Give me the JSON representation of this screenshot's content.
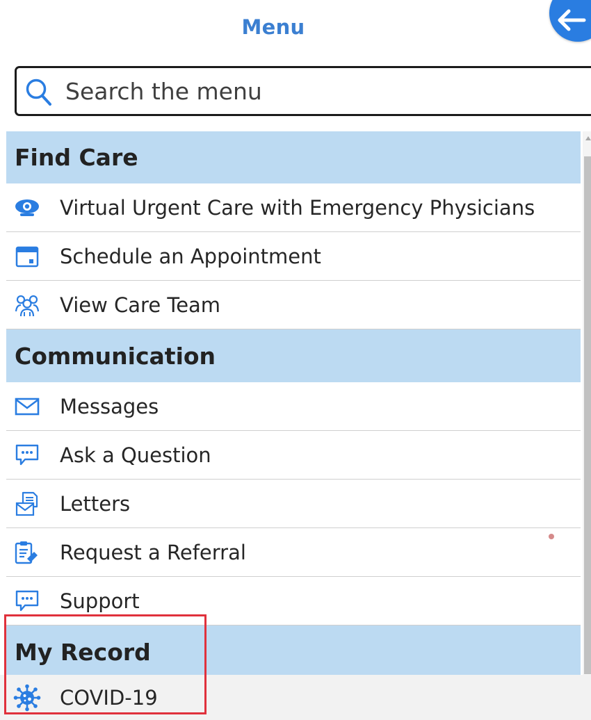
{
  "header": {
    "title": "Menu",
    "back_icon": "arrow-left-icon"
  },
  "search": {
    "placeholder": "Search the menu",
    "value": ""
  },
  "colors": {
    "accent": "#2a7de1",
    "title": "#3b7fd1",
    "section_bg": "#bcdaf2",
    "highlight": "#e0313c"
  },
  "sections": [
    {
      "title": "Find Care",
      "items": [
        {
          "label": "Virtual Urgent Care with Emergency Physicians",
          "icon": "webcam-icon"
        },
        {
          "label": "Schedule an Appointment",
          "icon": "calendar-icon"
        },
        {
          "label": "View Care Team",
          "icon": "care-team-icon"
        }
      ]
    },
    {
      "title": "Communication",
      "items": [
        {
          "label": "Messages",
          "icon": "envelope-icon"
        },
        {
          "label": "Ask a Question",
          "icon": "chat-bubble-icon"
        },
        {
          "label": "Letters",
          "icon": "letters-icon"
        },
        {
          "label": "Request a Referral",
          "icon": "referral-clipboard-icon"
        },
        {
          "label": "Support",
          "icon": "support-chat-icon"
        }
      ]
    },
    {
      "title": "My Record",
      "items": [
        {
          "label": "COVID-19",
          "icon": "virus-icon"
        }
      ]
    }
  ]
}
